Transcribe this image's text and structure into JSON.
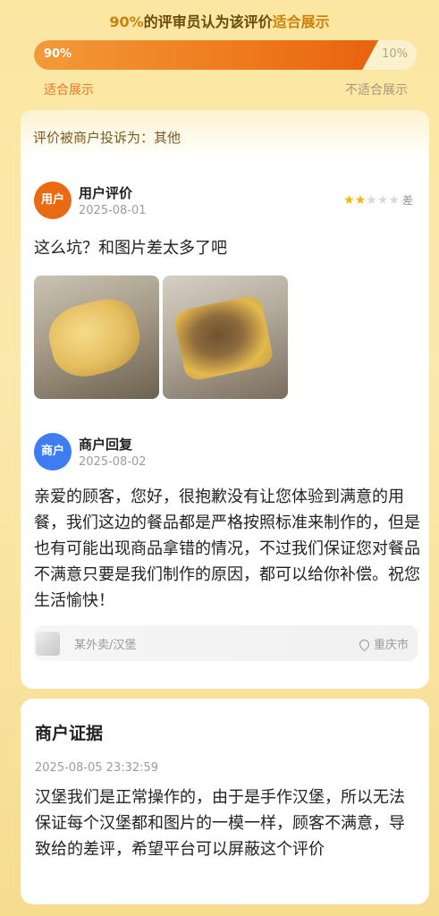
{
  "header": {
    "pct": "90%",
    "title_mid": "的评审员认为该评价",
    "title_accent": "适合展示"
  },
  "vote_bar": {
    "suitable_fraction": 0.9,
    "left_value": "90%",
    "right_value": "10%",
    "left_label": "适合展示",
    "right_label": "不适合展示",
    "fill_color": "#ef7a1c"
  },
  "complaint": {
    "label": "评价被商户投诉为：其他"
  },
  "user_review": {
    "avatar_text": "用户",
    "title": "用户评价",
    "date": "2025-08-01",
    "rating": 2,
    "rating_max": 5,
    "rating_label": "差",
    "text": "这么坑？和图片差太多了吧",
    "photos": [
      "burger-photo-1",
      "burger-photo-2"
    ]
  },
  "merchant_reply": {
    "avatar_text": "商户",
    "title": "商户回复",
    "date": "2025-08-02",
    "text": "亲爱的顾客，您好，很抱歉没有让您体验到满意的用餐，我们这边的餐品都是严格按照标准来制作的，但是也有可能出现商品拿错的情况，不过我们保证您对餐品不满意只要是我们制作的原因，都可以给你补偿。祝您生活愉快！"
  },
  "shop": {
    "name": "某外卖/汉堡",
    "location": "重庆市",
    "location_icon": "location-pin-icon"
  },
  "evidence": {
    "title": "商户证据",
    "time": "2025-08-05 23:32:59",
    "text": "汉堡我们是正常操作的，由于是手作汉堡，所以无法保证每个汉堡都和图片的一模一样，顾客不满意，导致给的差评，希望平台可以屏蔽这个评价"
  },
  "colors": {
    "accent_orange": "#e96a12",
    "merchant_blue": "#3e7cf1",
    "star_gold": "#f3b60f",
    "page_bg": "#fbe7a2"
  }
}
